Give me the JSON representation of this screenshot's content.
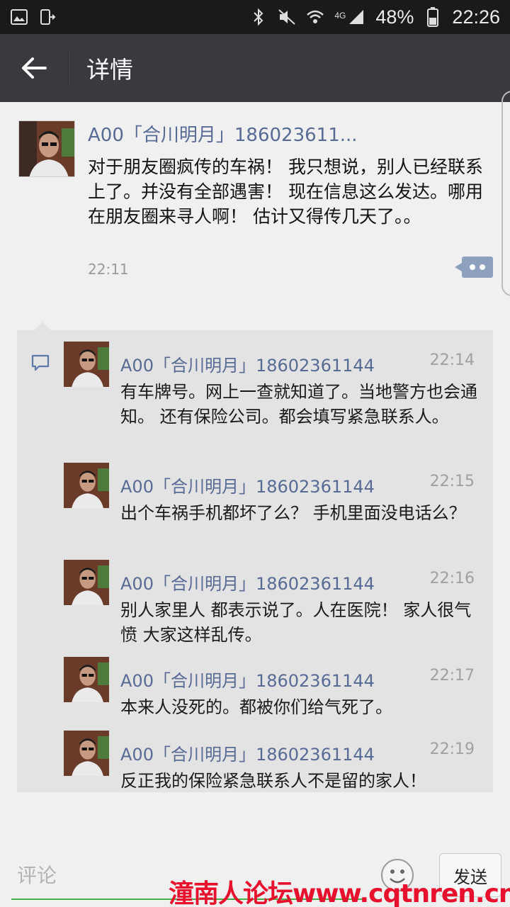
{
  "status_bar": {
    "battery_percent": "48%",
    "time": "22:26",
    "network": "4G",
    "icons": [
      "gallery-icon",
      "screen-mirror-icon",
      "bluetooth-icon",
      "mute-icon",
      "wifi-icon",
      "signal-icon",
      "battery-icon"
    ]
  },
  "title_bar": {
    "title": "详情",
    "back_icon": "arrow-left-icon",
    "background": "#393a3f"
  },
  "post": {
    "author": "A00「合川明月」186023611...",
    "text": "对于朋友圈疯传的车祸！ 我只想说，别人已经联系上了。并没有全部遇害！  现在信息这么发达。哪用在朋友圈来寻人啊！ 估计又得传几天了。。",
    "time": "22:11"
  },
  "comments": [
    {
      "author": "A00「合川明月」18602361144",
      "time": "22:14",
      "text": "有车牌号。网上一查就知道了。当地警方也会通知。 还有保险公司。都会填写紧急联系人。"
    },
    {
      "author": "A00「合川明月」18602361144",
      "time": "22:15",
      "text": "出个车祸手机都坏了么？ 手机里面没电话么？"
    },
    {
      "author": "A00「合川明月」18602361144",
      "time": "22:16",
      "text": "别人家里人 都表示说了。人在医院！  家人很气愤 大家这样乱传。"
    },
    {
      "author": "A00「合川明月」18602361144",
      "time": "22:17",
      "text": "本来人没死的。都被你们给气死了。"
    },
    {
      "author": "A00「合川明月」18602361144",
      "time": "22:19",
      "text": "反正我的保险紧急联系人不是留的家人！"
    }
  ],
  "comment_bar": {
    "placeholder": "评论",
    "send_label": "发送"
  },
  "watermark": "潼南人论坛www.cqtnren.cn",
  "colors": {
    "name_link": "#576b95",
    "accent_green": "#46b04a",
    "watermark_red": "#e8112d"
  }
}
